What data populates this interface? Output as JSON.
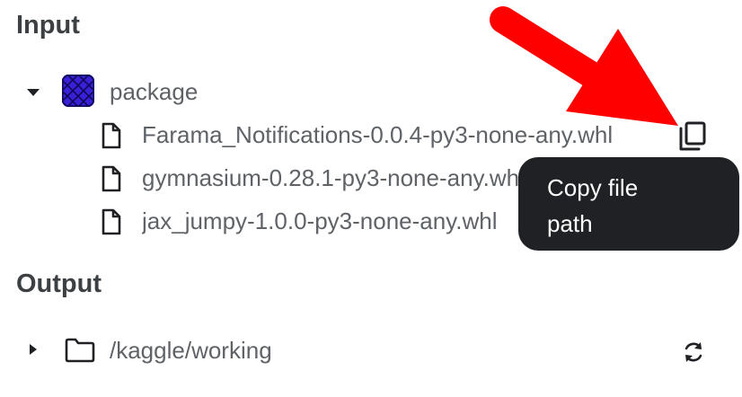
{
  "input": {
    "title": "Input",
    "package": {
      "label": "package",
      "icon": "package-dataset-icon",
      "expanded": true,
      "files": [
        {
          "name": "Farama_Notifications-0.0.4-py3-none-any.whl",
          "icon": "file-icon"
        },
        {
          "name": "gymnasium-0.28.1-py3-none-any.whl",
          "icon": "file-icon"
        },
        {
          "name": "jax_jumpy-1.0.0-py3-none-any.whl",
          "icon": "file-icon"
        }
      ]
    }
  },
  "tooltip": {
    "text": "Copy file path"
  },
  "output": {
    "title": "Output",
    "folder": {
      "label": "/kaggle/working",
      "icon": "folder-icon",
      "expanded": false
    }
  },
  "colors": {
    "annotation_arrow": "#ff0000",
    "tooltip_bg": "#202124",
    "package_icon": "#3a1fd6"
  }
}
